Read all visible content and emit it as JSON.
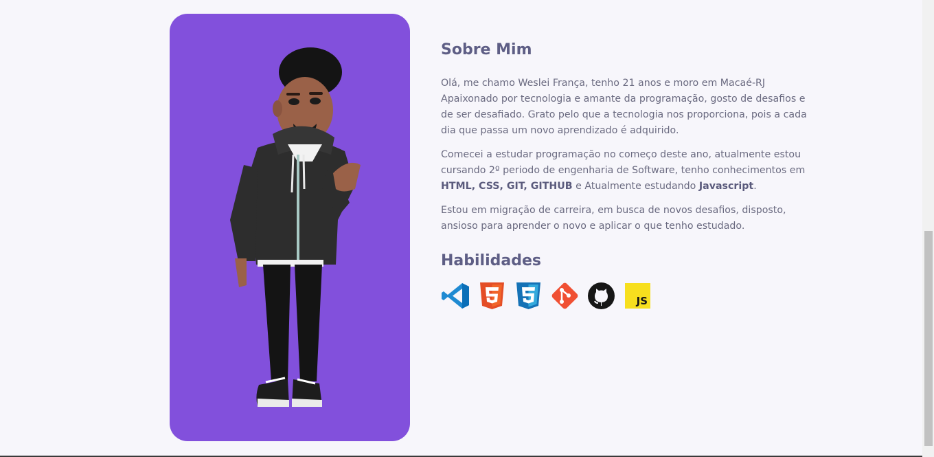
{
  "about": {
    "title": "Sobre Mim",
    "paragraph1_line1": "Olá, me chamo Weslei França, tenho 21 anos e moro em Macaé-RJ",
    "paragraph1_line2": "Apaixonado por tecnologia e amante da programação, gosto de desafios e de ser desafiado. Grato pelo que a tecnologia nos proporciona, pois a cada dia que passa um novo aprendizado é adquirido.",
    "paragraph2_intro": "Comecei a estudar programação no começo deste ano, atualmente estou cursando 2º periodo de engenharia de Software, tenho conhecimentos em",
    "paragraph2_known": "HTML, CSS, GIT, GITHUB",
    "paragraph2_mid": "e Atualmente estudando",
    "paragraph2_studying": "Javascript",
    "paragraph2_end": ".",
    "paragraph3": "Estou em migração de carreira, em busca de novos desafios, disposto, ansioso para aprender o novo e aplicar o que tenho estudado."
  },
  "skills": {
    "title": "Habilidades",
    "icons": [
      "vscode-icon",
      "html5-icon",
      "css3-icon",
      "git-icon",
      "github-icon",
      "javascript-icon"
    ],
    "js_label": "JS"
  },
  "colors": {
    "card_background": "#8250dc",
    "title": "#5e5e85",
    "text": "#6a6a80",
    "page_background": "#f7f6fb"
  }
}
